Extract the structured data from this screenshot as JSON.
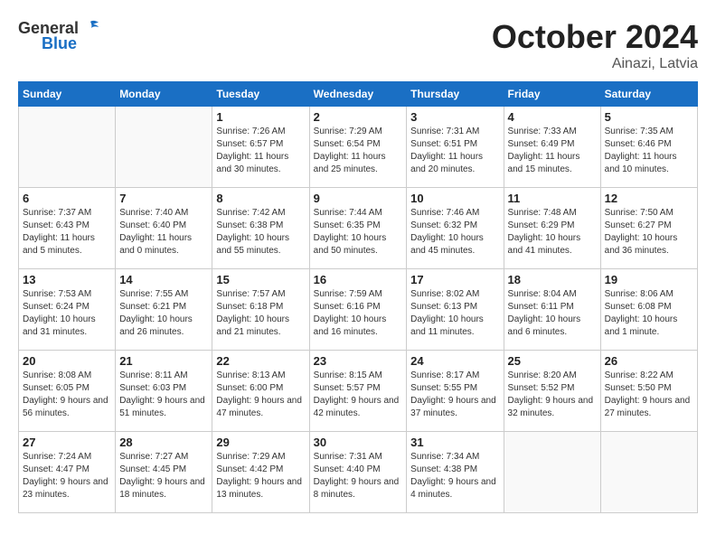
{
  "header": {
    "logo_general": "General",
    "logo_blue": "Blue",
    "title": "October 2024",
    "location": "Ainazi, Latvia"
  },
  "days_of_week": [
    "Sunday",
    "Monday",
    "Tuesday",
    "Wednesday",
    "Thursday",
    "Friday",
    "Saturday"
  ],
  "weeks": [
    [
      {
        "day": "",
        "info": ""
      },
      {
        "day": "",
        "info": ""
      },
      {
        "day": "1",
        "info": "Sunrise: 7:26 AM\nSunset: 6:57 PM\nDaylight: 11 hours and 30 minutes."
      },
      {
        "day": "2",
        "info": "Sunrise: 7:29 AM\nSunset: 6:54 PM\nDaylight: 11 hours and 25 minutes."
      },
      {
        "day": "3",
        "info": "Sunrise: 7:31 AM\nSunset: 6:51 PM\nDaylight: 11 hours and 20 minutes."
      },
      {
        "day": "4",
        "info": "Sunrise: 7:33 AM\nSunset: 6:49 PM\nDaylight: 11 hours and 15 minutes."
      },
      {
        "day": "5",
        "info": "Sunrise: 7:35 AM\nSunset: 6:46 PM\nDaylight: 11 hours and 10 minutes."
      }
    ],
    [
      {
        "day": "6",
        "info": "Sunrise: 7:37 AM\nSunset: 6:43 PM\nDaylight: 11 hours and 5 minutes."
      },
      {
        "day": "7",
        "info": "Sunrise: 7:40 AM\nSunset: 6:40 PM\nDaylight: 11 hours and 0 minutes."
      },
      {
        "day": "8",
        "info": "Sunrise: 7:42 AM\nSunset: 6:38 PM\nDaylight: 10 hours and 55 minutes."
      },
      {
        "day": "9",
        "info": "Sunrise: 7:44 AM\nSunset: 6:35 PM\nDaylight: 10 hours and 50 minutes."
      },
      {
        "day": "10",
        "info": "Sunrise: 7:46 AM\nSunset: 6:32 PM\nDaylight: 10 hours and 45 minutes."
      },
      {
        "day": "11",
        "info": "Sunrise: 7:48 AM\nSunset: 6:29 PM\nDaylight: 10 hours and 41 minutes."
      },
      {
        "day": "12",
        "info": "Sunrise: 7:50 AM\nSunset: 6:27 PM\nDaylight: 10 hours and 36 minutes."
      }
    ],
    [
      {
        "day": "13",
        "info": "Sunrise: 7:53 AM\nSunset: 6:24 PM\nDaylight: 10 hours and 31 minutes."
      },
      {
        "day": "14",
        "info": "Sunrise: 7:55 AM\nSunset: 6:21 PM\nDaylight: 10 hours and 26 minutes."
      },
      {
        "day": "15",
        "info": "Sunrise: 7:57 AM\nSunset: 6:18 PM\nDaylight: 10 hours and 21 minutes."
      },
      {
        "day": "16",
        "info": "Sunrise: 7:59 AM\nSunset: 6:16 PM\nDaylight: 10 hours and 16 minutes."
      },
      {
        "day": "17",
        "info": "Sunrise: 8:02 AM\nSunset: 6:13 PM\nDaylight: 10 hours and 11 minutes."
      },
      {
        "day": "18",
        "info": "Sunrise: 8:04 AM\nSunset: 6:11 PM\nDaylight: 10 hours and 6 minutes."
      },
      {
        "day": "19",
        "info": "Sunrise: 8:06 AM\nSunset: 6:08 PM\nDaylight: 10 hours and 1 minute."
      }
    ],
    [
      {
        "day": "20",
        "info": "Sunrise: 8:08 AM\nSunset: 6:05 PM\nDaylight: 9 hours and 56 minutes."
      },
      {
        "day": "21",
        "info": "Sunrise: 8:11 AM\nSunset: 6:03 PM\nDaylight: 9 hours and 51 minutes."
      },
      {
        "day": "22",
        "info": "Sunrise: 8:13 AM\nSunset: 6:00 PM\nDaylight: 9 hours and 47 minutes."
      },
      {
        "day": "23",
        "info": "Sunrise: 8:15 AM\nSunset: 5:57 PM\nDaylight: 9 hours and 42 minutes."
      },
      {
        "day": "24",
        "info": "Sunrise: 8:17 AM\nSunset: 5:55 PM\nDaylight: 9 hours and 37 minutes."
      },
      {
        "day": "25",
        "info": "Sunrise: 8:20 AM\nSunset: 5:52 PM\nDaylight: 9 hours and 32 minutes."
      },
      {
        "day": "26",
        "info": "Sunrise: 8:22 AM\nSunset: 5:50 PM\nDaylight: 9 hours and 27 minutes."
      }
    ],
    [
      {
        "day": "27",
        "info": "Sunrise: 7:24 AM\nSunset: 4:47 PM\nDaylight: 9 hours and 23 minutes."
      },
      {
        "day": "28",
        "info": "Sunrise: 7:27 AM\nSunset: 4:45 PM\nDaylight: 9 hours and 18 minutes."
      },
      {
        "day": "29",
        "info": "Sunrise: 7:29 AM\nSunset: 4:42 PM\nDaylight: 9 hours and 13 minutes."
      },
      {
        "day": "30",
        "info": "Sunrise: 7:31 AM\nSunset: 4:40 PM\nDaylight: 9 hours and 8 minutes."
      },
      {
        "day": "31",
        "info": "Sunrise: 7:34 AM\nSunset: 4:38 PM\nDaylight: 9 hours and 4 minutes."
      },
      {
        "day": "",
        "info": ""
      },
      {
        "day": "",
        "info": ""
      }
    ]
  ]
}
